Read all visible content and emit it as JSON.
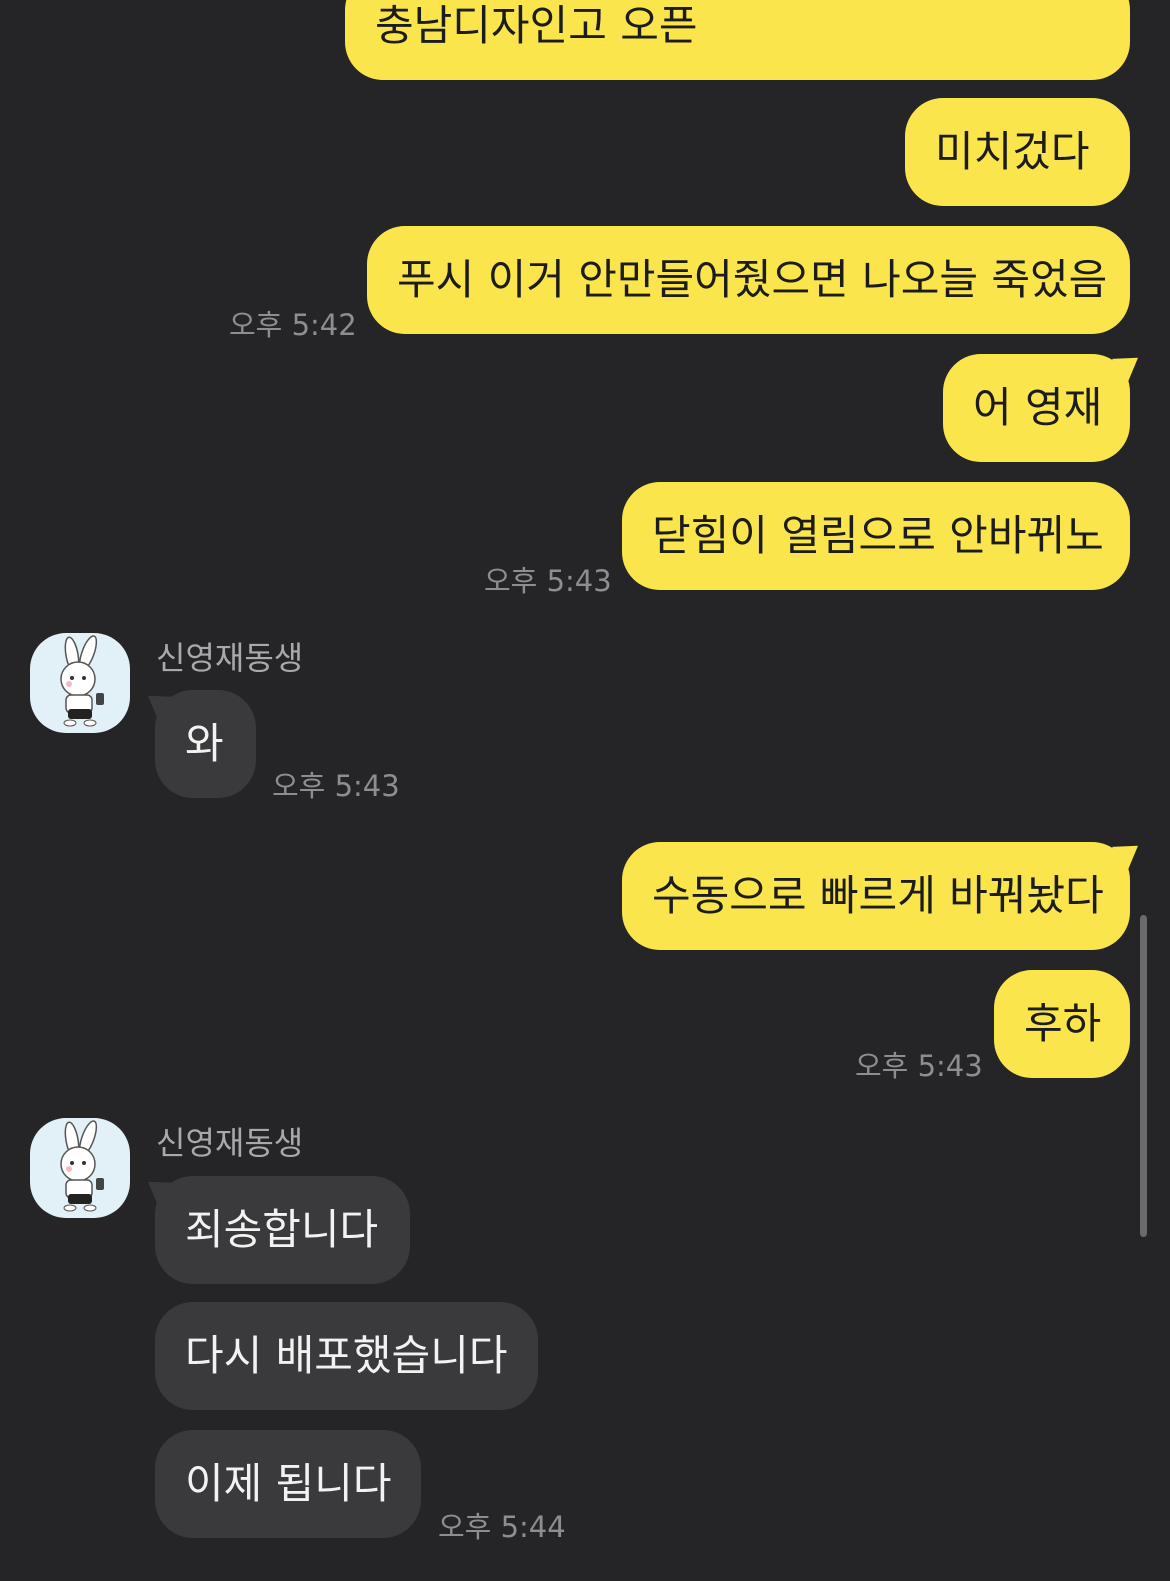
{
  "messages": {
    "m1": "충남디자인고 오픈",
    "m2": "미치겄다",
    "m3": "푸시 이거 안만들어줬으면 나오늘 죽었음",
    "m4": "어 영재",
    "m5": "닫힘이 열림으로 안바뀌노",
    "m6": "와",
    "m7": "수동으로 빠르게 바꿔놨다",
    "m8": "후하",
    "m9": "죄송합니다",
    "m10": "다시 배포했습니다",
    "m11": "이제 됩니다"
  },
  "times": {
    "t1": "오후 5:42",
    "t2": "오후 5:43",
    "t3": "오후 5:43",
    "t4": "오후 5:43",
    "t5": "오후 5:44"
  },
  "contact": {
    "name": "신영재동생"
  },
  "colors": {
    "background": "#252527",
    "outgoing_bubble": "#FAE54C",
    "incoming_bubble": "#3a3a3c",
    "timestamp": "#8d8d92"
  },
  "icons": {
    "avatar": "rabbit-character-avatar"
  }
}
